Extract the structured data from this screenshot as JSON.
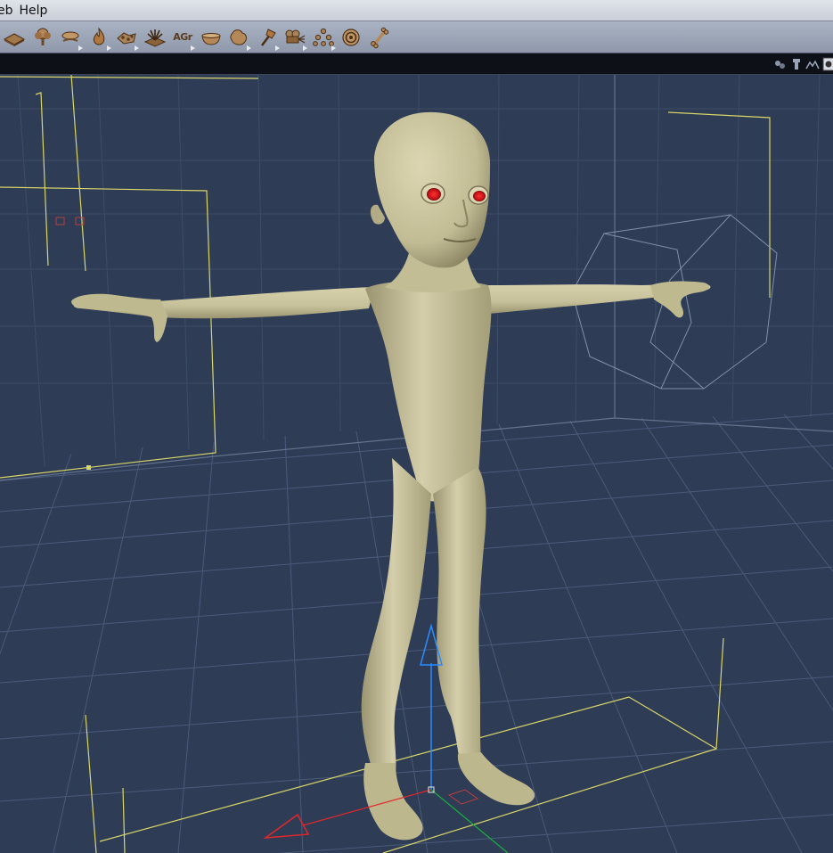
{
  "menubar": {
    "items": [
      {
        "label": "eb"
      },
      {
        "label": "Help"
      }
    ]
  },
  "toolbar": {
    "tools": [
      {
        "icon": "ground-plane-icon",
        "flyout": false
      },
      {
        "icon": "tree-icon",
        "flyout": false
      },
      {
        "icon": "terrain-icon",
        "flyout": true
      },
      {
        "icon": "fire-icon",
        "flyout": true
      },
      {
        "icon": "rocks-icon",
        "flyout": true
      },
      {
        "icon": "plant-icon",
        "flyout": false
      },
      {
        "icon": "text-icon",
        "label": "AGr",
        "flyout": true
      },
      {
        "icon": "bowl-icon",
        "flyout": false
      },
      {
        "icon": "blob-icon",
        "flyout": true
      },
      {
        "icon": "torch-icon",
        "flyout": true
      },
      {
        "icon": "camera-light-icon",
        "flyout": true
      },
      {
        "icon": "hierarchy-icon",
        "flyout": true
      },
      {
        "icon": "target-icon",
        "flyout": false
      },
      {
        "icon": "bone-icon",
        "flyout": false
      }
    ]
  },
  "viewport": {
    "controls": [
      {
        "icon": "hands-icon"
      },
      {
        "icon": "camera-stack-icon"
      },
      {
        "icon": "figure-pose-icon"
      },
      {
        "icon": "render-icon"
      }
    ],
    "colors": {
      "background": "#2e3c55",
      "grid": "#4a5a76",
      "bounding_box": "#d9d66a",
      "figure_skin": "#c9c39a",
      "eye": "#c8141a",
      "axis_y": "#2a8cff",
      "axis_x": "#e0282c",
      "axis_z": "#18b040"
    }
  }
}
